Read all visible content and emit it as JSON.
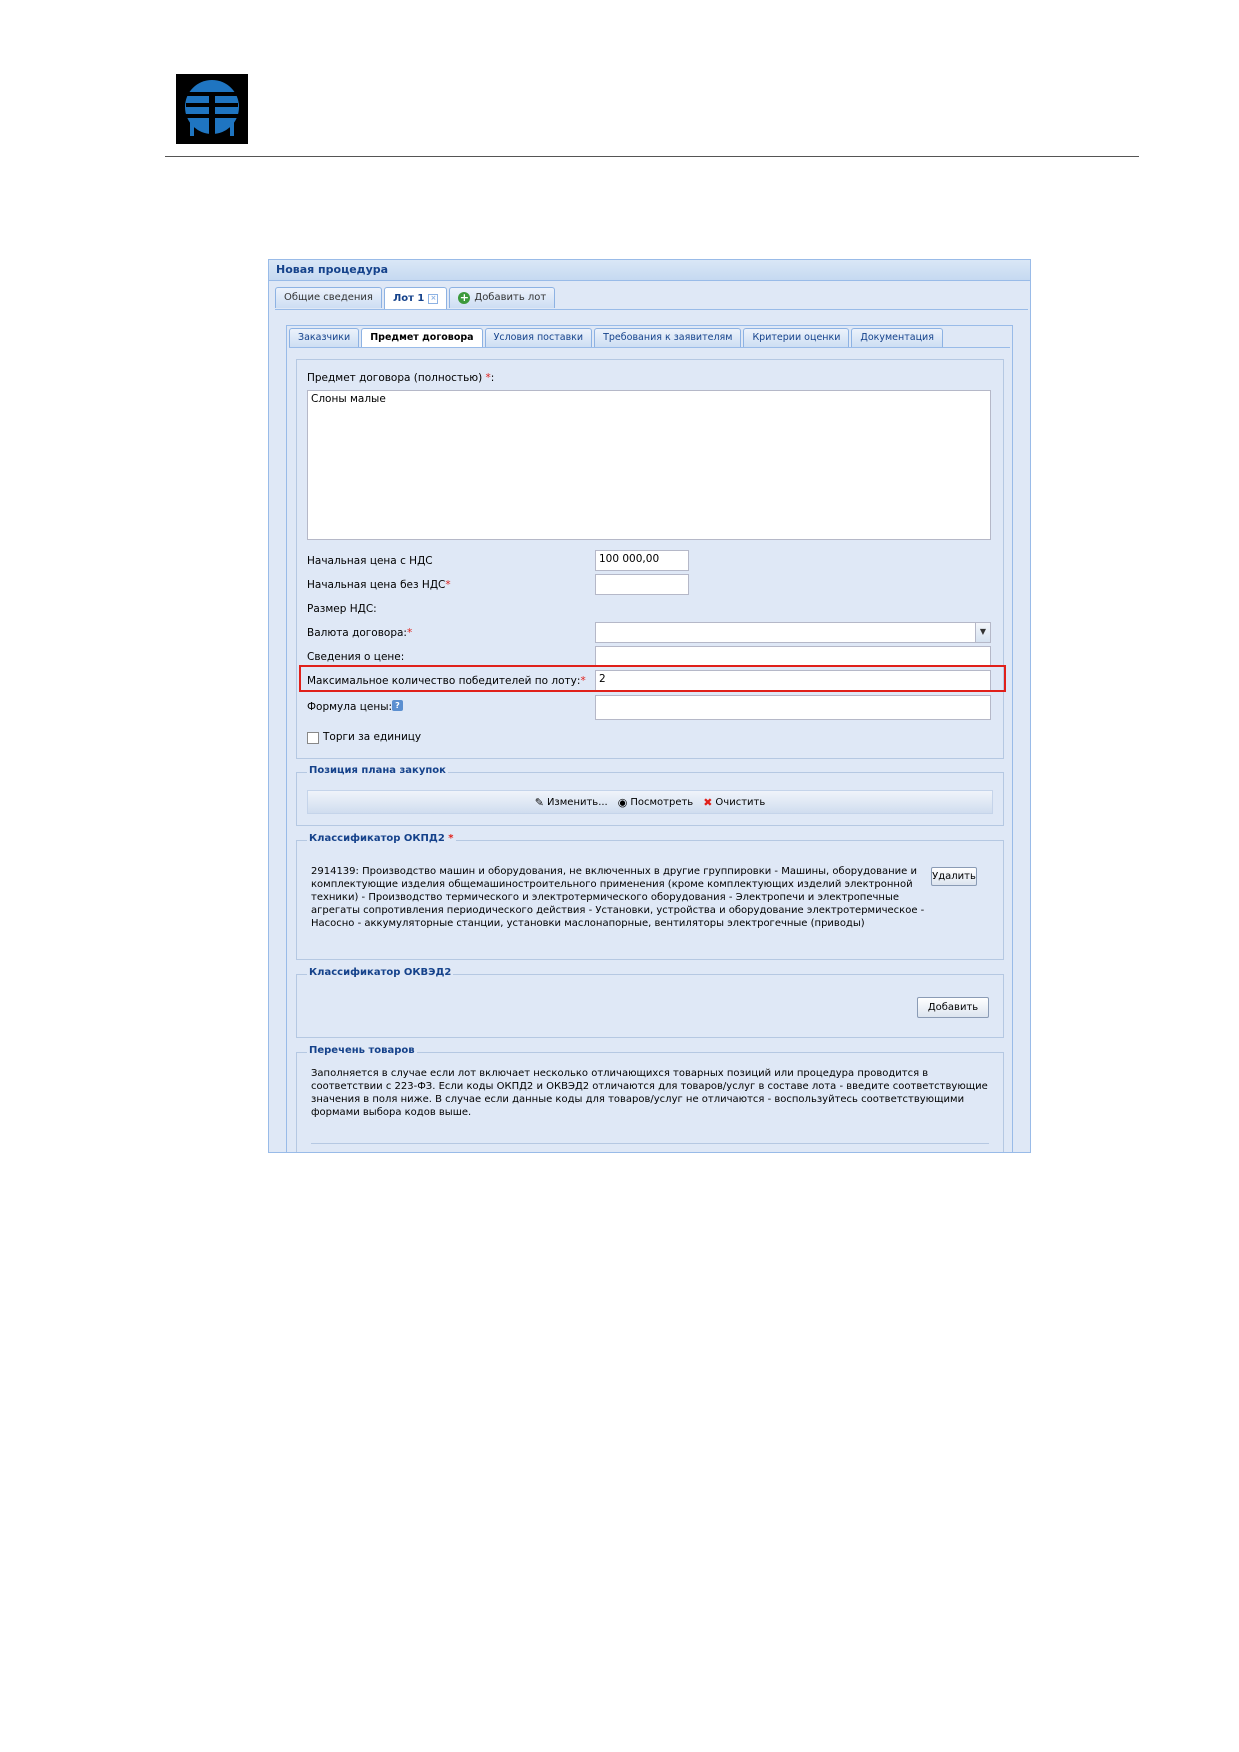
{
  "window": {
    "title": "Новая процедура",
    "tabs": [
      {
        "label": "Общие сведения"
      },
      {
        "label": "Лот 1"
      },
      {
        "label": "Добавить лот"
      }
    ]
  },
  "inner_tabs": [
    {
      "label": "Заказчики"
    },
    {
      "label": "Предмет договора"
    },
    {
      "label": "Условия поставки"
    },
    {
      "label": "Требования к заявителям"
    },
    {
      "label": "Критерии оценки"
    },
    {
      "label": "Документация"
    }
  ],
  "form": {
    "subject_label": "Предмет договора (полностью)",
    "subject_value": "Слоны малые",
    "price_with_vat_label": "Начальная цена с НДС",
    "price_with_vat_value": "100 000,00",
    "price_without_vat_label": "Начальная цена без НДС",
    "price_without_vat_value": "",
    "vat_size_label": "Размер НДС:",
    "currency_label": "Валюта договора:",
    "currency_value": "",
    "price_info_label": "Сведения о цене:",
    "price_info_value": "",
    "max_winners_label": "Максимальное количество победителей по лоту:",
    "max_winners_value": "2",
    "price_formula_label": "Формула цены:",
    "price_formula_value": "",
    "per_unit_label": "Торги за единицу",
    "required_mark": "*"
  },
  "plan_position": {
    "legend": "Позиция плана закупок",
    "edit_label": "Изменить...",
    "view_label": "Посмотреть",
    "clear_label": "Очистить"
  },
  "okpd2": {
    "legend": "Классификатор ОКПД2",
    "text": "2914139: Производство машин и оборудования, не включенных в другие группировки - Машины, оборудование и комплектующие изделия общемашиностроительного применения (кроме комплектующих изделий электронной техники) - Производство термического и электротермического оборудования - Электропечи и электропечные агрегаты сопротивления периодического действия - Установки, устройства и оборудование электротермическое - Насосно - аккумуляторные станции, установки маслонапорные, вентиляторы электрогечные (приводы)",
    "delete_label": "Удалить"
  },
  "okved2": {
    "legend": "Классификатор ОКВЭД2",
    "add_label": "Добавить"
  },
  "goods": {
    "legend": "Перечень товаров",
    "text": "Заполняется в случае если лот включает несколько отличающихся товарных позиций или процедура проводится в соответствии с 223-ФЗ. Если коды ОКПД2 и ОКВЭД2 отличаются для товаров/услуг в составе лота - введите соответствующие значения в поля ниже. В случае если данные коды для товаров/услуг не отличаются - воспользуйтесь соответствующими формами выбора кодов выше."
  },
  "colors": {
    "panel_bg": "#dfe8f6",
    "title_text": "#15428b",
    "required": "#e0201a",
    "highlight_border": "#e0201a"
  }
}
